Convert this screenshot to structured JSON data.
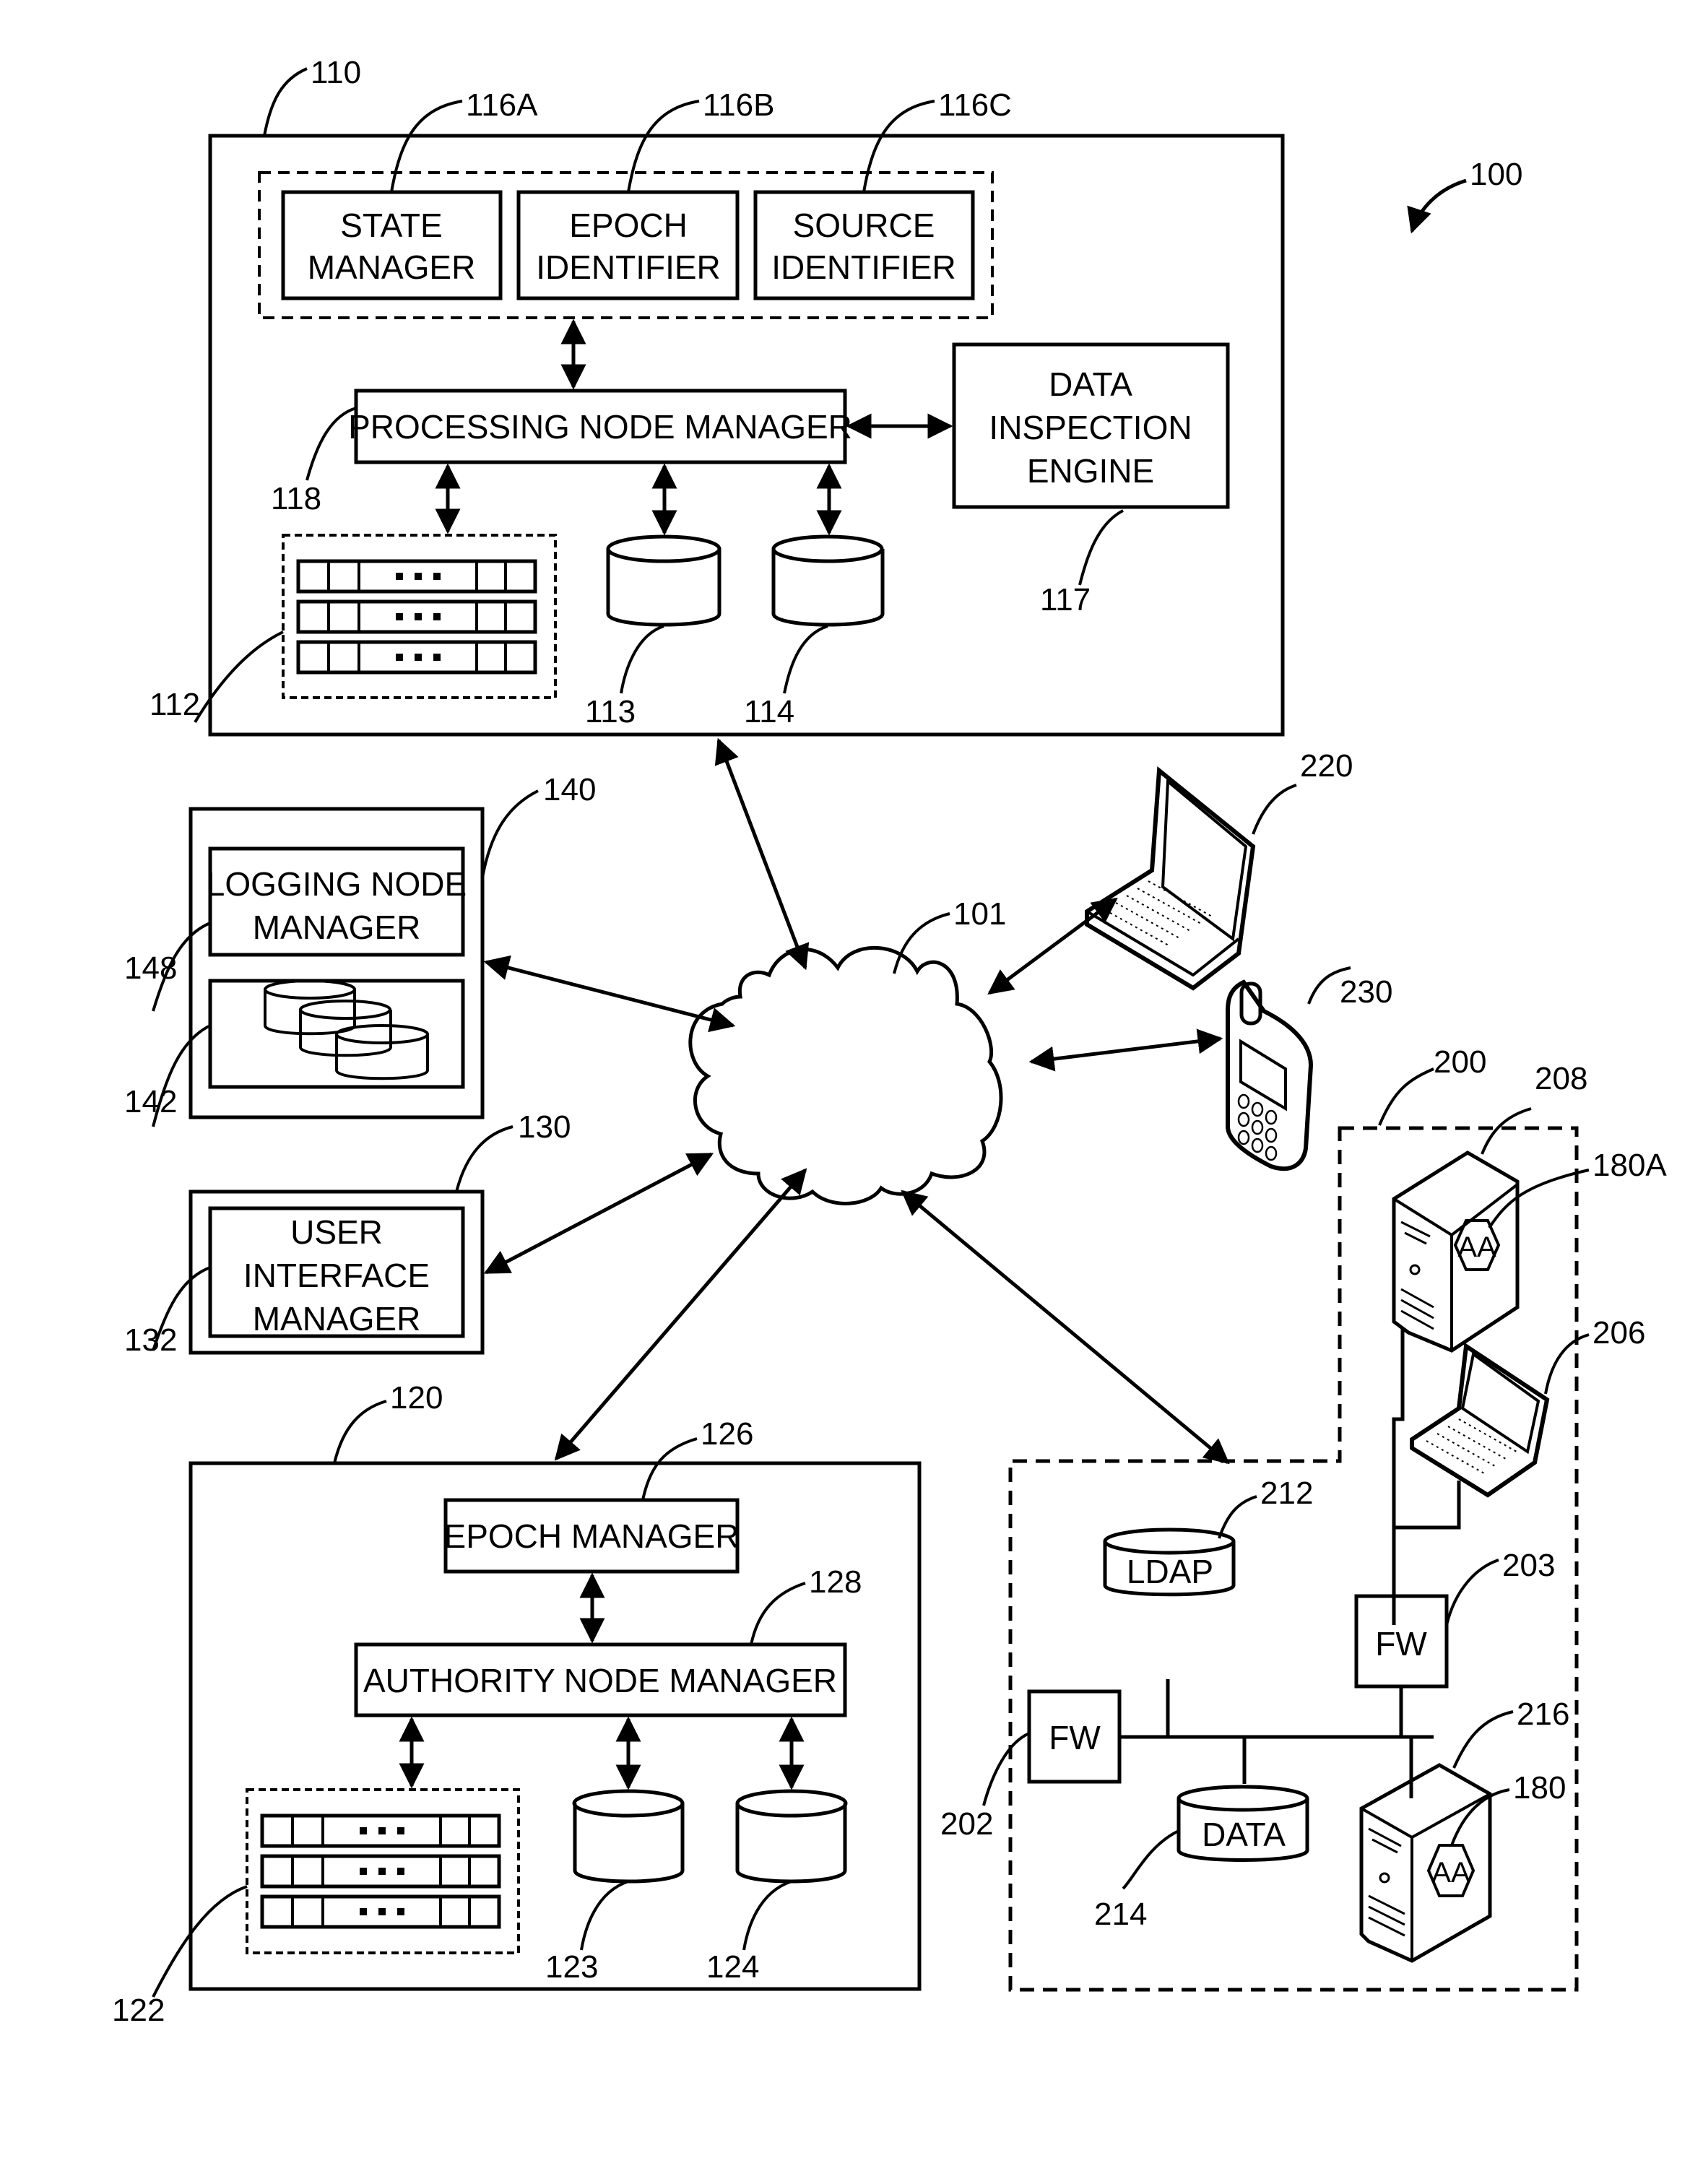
{
  "figure": {
    "reference": "100",
    "network": {
      "ref": "101"
    }
  },
  "system_110": {
    "ref": "110",
    "group_116": [
      {
        "ref": "116A",
        "lines": [
          "STATE",
          "MANAGER"
        ]
      },
      {
        "ref": "116B",
        "lines": [
          "EPOCH",
          "IDENTIFIER"
        ]
      },
      {
        "ref": "116C",
        "lines": [
          "SOURCE",
          "IDENTIFIER"
        ]
      }
    ],
    "processing_node_manager": {
      "ref": "118",
      "label": "PROCESSING NODE MANAGER"
    },
    "data_inspection_engine": {
      "ref": "117",
      "lines": [
        "DATA",
        "INSPECTION",
        "ENGINE"
      ]
    },
    "server_rack": {
      "ref": "112",
      "dots": "■ ■ ■"
    },
    "datastore_a": {
      "ref": "113"
    },
    "datastore_b": {
      "ref": "114"
    }
  },
  "logging_140": {
    "ref": "140",
    "logging_node_manager": {
      "ref": "148",
      "lines": [
        "LOGGING NODE",
        "MANAGER"
      ]
    },
    "log_storage": {
      "ref": "142"
    }
  },
  "ui_130": {
    "ref": "130",
    "user_interface_manager": {
      "ref": "132",
      "lines": [
        "USER",
        "INTERFACE",
        "MANAGER"
      ]
    }
  },
  "authority_120": {
    "ref": "120",
    "epoch_manager": {
      "ref": "126",
      "label": "EPOCH MANAGER"
    },
    "authority_node_manager": {
      "ref": "128",
      "label": "AUTHORITY NODE MANAGER"
    },
    "server_rack": {
      "ref": "122",
      "dots": "■ ■ ■"
    },
    "datastore_a": {
      "ref": "123"
    },
    "datastore_b": {
      "ref": "124"
    }
  },
  "devices": {
    "laptop": {
      "ref": "220"
    },
    "phone": {
      "ref": "230"
    }
  },
  "enterprise_200": {
    "ref": "200",
    "server_top": {
      "ref": "208",
      "agent_ref": "180A",
      "agent_label": "AA"
    },
    "laptop": {
      "ref": "206"
    },
    "firewall_203": {
      "ref": "203",
      "label": "FW"
    },
    "firewall_202": {
      "ref": "202",
      "label": "FW"
    },
    "ldap": {
      "ref": "212",
      "label": "LDAP"
    },
    "data_store": {
      "ref": "214",
      "label": "DATA"
    },
    "server_bottom": {
      "ref": "216",
      "agent_ref": "180",
      "agent_label": "AA"
    }
  }
}
